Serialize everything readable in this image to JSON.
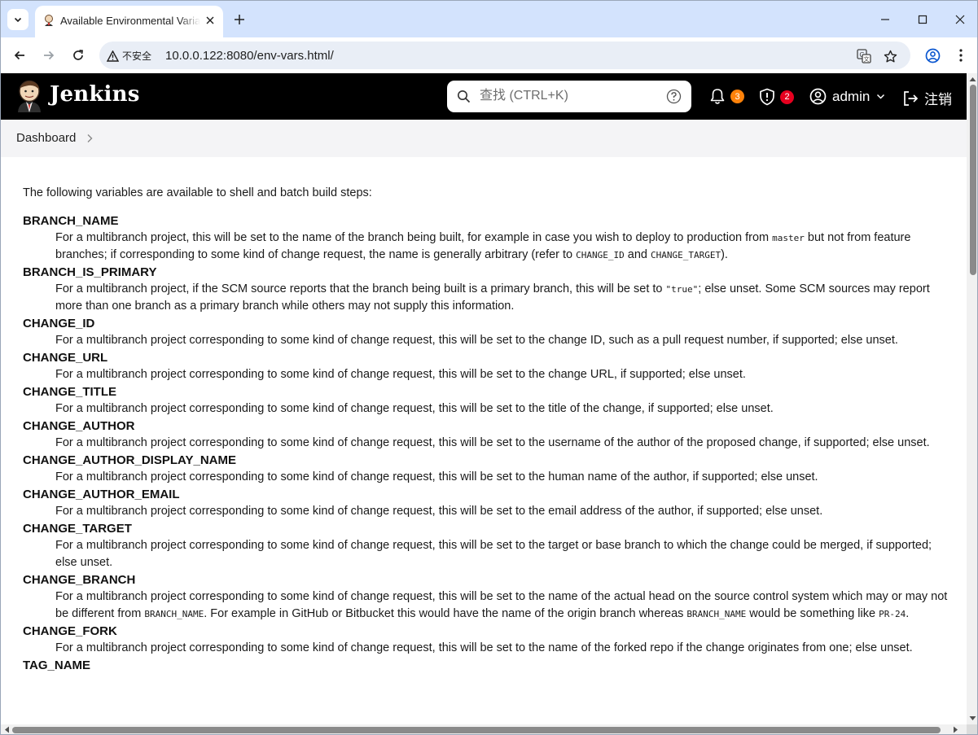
{
  "browser": {
    "tab_title": "Available Environmental Variables",
    "security_label": "不安全",
    "url": "10.0.0.122:8080/env-vars.html/"
  },
  "header": {
    "brand": "Jenkins",
    "search_placeholder": "查找 (CTRL+K)",
    "notifications_count": "3",
    "security_count": "2",
    "user_name": "admin",
    "logout_label": "注销",
    "colors": {
      "notification_badge": "#fe820a",
      "security_badge": "#e6001f",
      "header_bg": "#000000"
    }
  },
  "breadcrumb": {
    "items": [
      "Dashboard"
    ]
  },
  "content": {
    "intro": "The following variables are available to shell and batch build steps:",
    "vars": [
      {
        "name": "BRANCH_NAME",
        "desc": [
          {
            "t": "For a multibranch project, this will be set to the name of the branch being built, for example in case you wish to deploy to production from "
          },
          {
            "c": "master"
          },
          {
            "t": " but not from feature branches; if corresponding to some kind of change request, the name is generally arbitrary (refer to "
          },
          {
            "c": "CHANGE_ID"
          },
          {
            "t": " and "
          },
          {
            "c": "CHANGE_TARGET"
          },
          {
            "t": ")."
          }
        ]
      },
      {
        "name": "BRANCH_IS_PRIMARY",
        "desc": [
          {
            "t": "For a multibranch project, if the SCM source reports that the branch being built is a primary branch, this will be set to "
          },
          {
            "c": "\"true\""
          },
          {
            "t": "; else unset. Some SCM sources may report more than one branch as a primary branch while others may not supply this information."
          }
        ]
      },
      {
        "name": "CHANGE_ID",
        "desc": [
          {
            "t": "For a multibranch project corresponding to some kind of change request, this will be set to the change ID, such as a pull request number, if supported; else unset."
          }
        ]
      },
      {
        "name": "CHANGE_URL",
        "desc": [
          {
            "t": "For a multibranch project corresponding to some kind of change request, this will be set to the change URL, if supported; else unset."
          }
        ]
      },
      {
        "name": "CHANGE_TITLE",
        "desc": [
          {
            "t": "For a multibranch project corresponding to some kind of change request, this will be set to the title of the change, if supported; else unset."
          }
        ]
      },
      {
        "name": "CHANGE_AUTHOR",
        "desc": [
          {
            "t": "For a multibranch project corresponding to some kind of change request, this will be set to the username of the author of the proposed change, if supported; else unset."
          }
        ]
      },
      {
        "name": "CHANGE_AUTHOR_DISPLAY_NAME",
        "desc": [
          {
            "t": "For a multibranch project corresponding to some kind of change request, this will be set to the human name of the author, if supported; else unset."
          }
        ]
      },
      {
        "name": "CHANGE_AUTHOR_EMAIL",
        "desc": [
          {
            "t": "For a multibranch project corresponding to some kind of change request, this will be set to the email address of the author, if supported; else unset."
          }
        ]
      },
      {
        "name": "CHANGE_TARGET",
        "desc": [
          {
            "t": "For a multibranch project corresponding to some kind of change request, this will be set to the target or base branch to which the change could be merged, if supported; else unset."
          }
        ]
      },
      {
        "name": "CHANGE_BRANCH",
        "desc": [
          {
            "t": "For a multibranch project corresponding to some kind of change request, this will be set to the name of the actual head on the source control system which may or may not be different from "
          },
          {
            "c": "BRANCH_NAME"
          },
          {
            "t": ". For example in GitHub or Bitbucket this would have the name of the origin branch whereas "
          },
          {
            "c": "BRANCH_NAME"
          },
          {
            "t": " would be something like "
          },
          {
            "c": "PR-24"
          },
          {
            "t": "."
          }
        ]
      },
      {
        "name": "CHANGE_FORK",
        "desc": [
          {
            "t": "For a multibranch project corresponding to some kind of change request, this will be set to the name of the forked repo if the change originates from one; else unset."
          }
        ]
      },
      {
        "name": "TAG_NAME",
        "desc": []
      }
    ]
  }
}
